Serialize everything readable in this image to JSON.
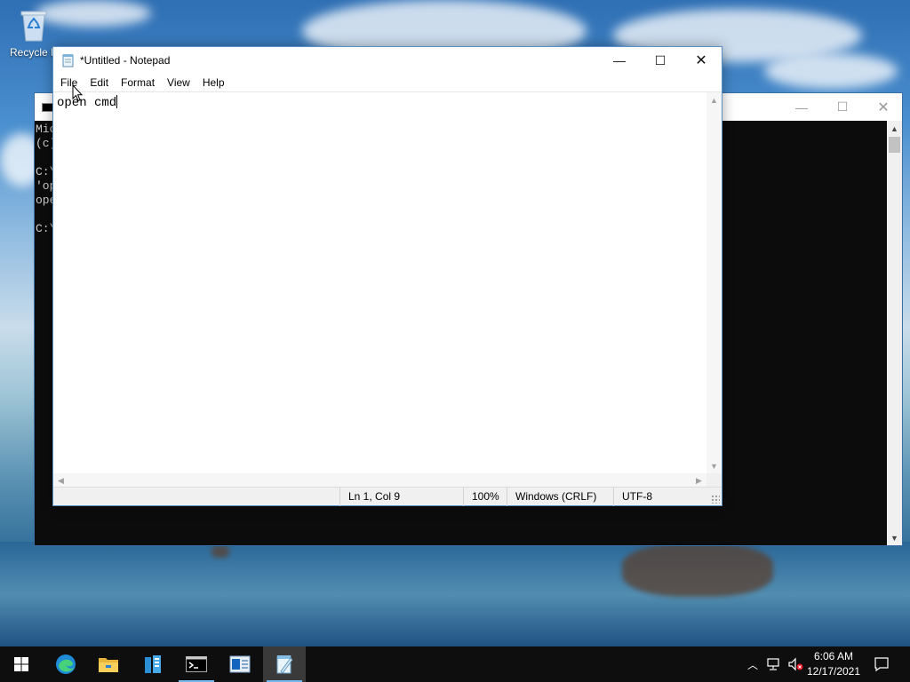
{
  "desktop": {
    "recycle_bin_label": "Recycle B"
  },
  "cmd_window": {
    "lines": [
      "Mic",
      "(c)",
      "",
      "C:\\",
      "'op",
      "ope",
      "",
      "C:\\"
    ]
  },
  "notepad": {
    "title": "*Untitled - Notepad",
    "menu": [
      "File",
      "Edit",
      "Format",
      "View",
      "Help"
    ],
    "content": "open cmd",
    "status": {
      "position": "Ln 1, Col 9",
      "zoom": "100%",
      "line_ending": "Windows (CRLF)",
      "encoding": "UTF-8"
    }
  },
  "taskbar": {
    "apps": [
      "start-icon",
      "edge-icon",
      "file-explorer-icon",
      "server-manager-icon",
      "cmd-icon",
      "outlook-icon",
      "notepad-icon"
    ],
    "time": "6:06 AM",
    "date": "12/17/2021"
  },
  "colors": {
    "taskbar_bg": "#0e0e0e",
    "accent": "#76b9ed",
    "cmd_bg": "#0c0c0c"
  }
}
